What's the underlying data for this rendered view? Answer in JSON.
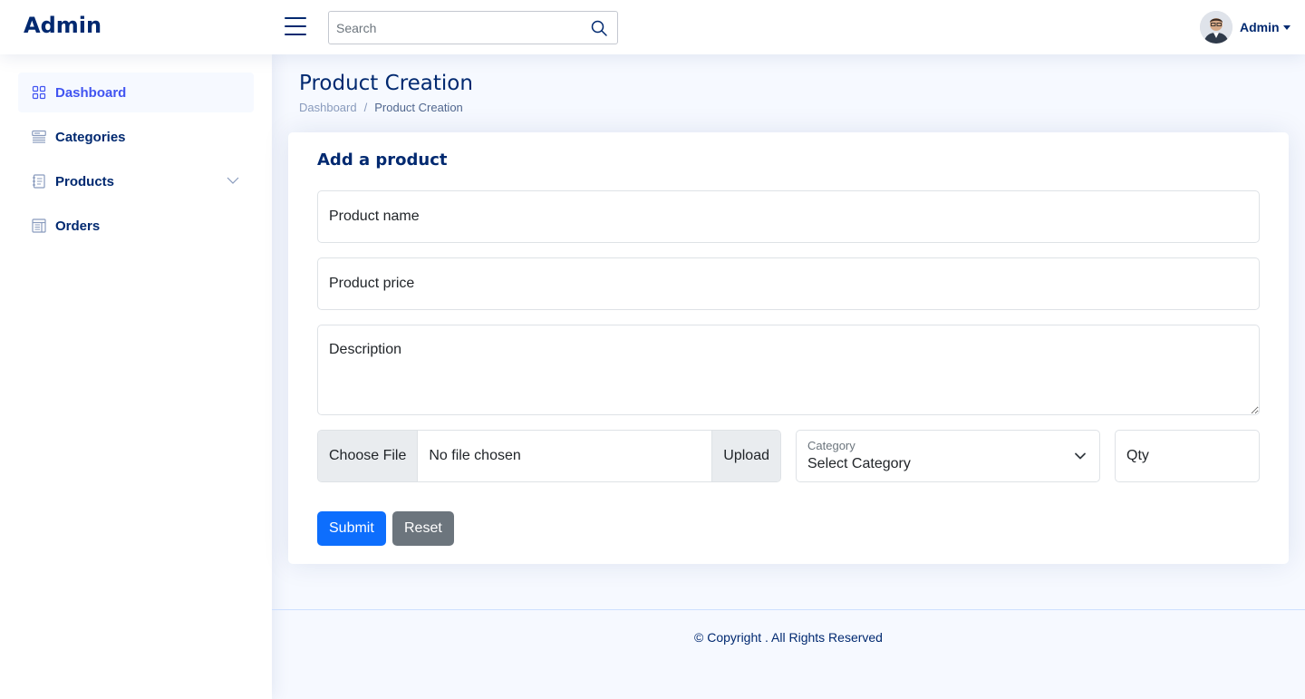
{
  "header": {
    "logo": "Admin",
    "search_placeholder": "Search",
    "profile_name": "Admin"
  },
  "sidebar": {
    "items": [
      {
        "label": "Dashboard",
        "icon": "grid-icon",
        "active": true
      },
      {
        "label": "Categories",
        "icon": "menu-button-icon",
        "active": false
      },
      {
        "label": "Products",
        "icon": "journal-text-icon",
        "active": false,
        "expandable": true
      },
      {
        "label": "Orders",
        "icon": "layout-text-window-icon",
        "active": false
      }
    ]
  },
  "page": {
    "title": "Product Creation",
    "breadcrumb": {
      "home": "Dashboard",
      "separator": "/",
      "current": "Product Creation"
    }
  },
  "form": {
    "title": "Add a product",
    "product_name_placeholder": "Product name",
    "product_price_placeholder": "Product price",
    "description_placeholder": "Description",
    "file_button": "Choose File",
    "file_status": "No file chosen",
    "upload_button": "Upload",
    "category_label": "Category",
    "category_value": "Select Category",
    "qty_placeholder": "Qty",
    "submit_label": "Submit",
    "reset_label": "Reset"
  },
  "footer": {
    "text": "© Copyright . All Rights Reserved"
  },
  "colors": {
    "brand": "#012970",
    "active": "#4154f1",
    "primary": "#0d6efd",
    "secondary": "#6c757d",
    "background": "#f6f9ff"
  }
}
